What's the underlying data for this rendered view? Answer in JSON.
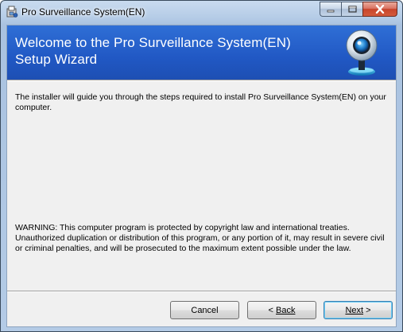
{
  "window": {
    "title": "Pro Surveillance System(EN)",
    "controls": {
      "minimize_icon": "minimize-icon",
      "maximize_icon": "maximize-icon",
      "close_icon": "close-icon"
    }
  },
  "banner": {
    "title": "Welcome to the Pro Surveillance System(EN)\nSetup Wizard",
    "logo_icon": "webcam-icon",
    "background_color": "#2158c4"
  },
  "content": {
    "intro": "The installer will guide you through the steps required to install Pro Surveillance System(EN) on your computer.",
    "warning": "WARNING: This computer program is protected by copyright law and international treaties. Unauthorized duplication or distribution of this program, or any portion of it, may result in severe civil or criminal penalties, and will be prosecuted to the maximum extent possible under the law."
  },
  "buttons": {
    "cancel": "Cancel",
    "back_arrow": "<",
    "back_label": "Back",
    "next_label": "Next",
    "next_arrow": ">"
  }
}
